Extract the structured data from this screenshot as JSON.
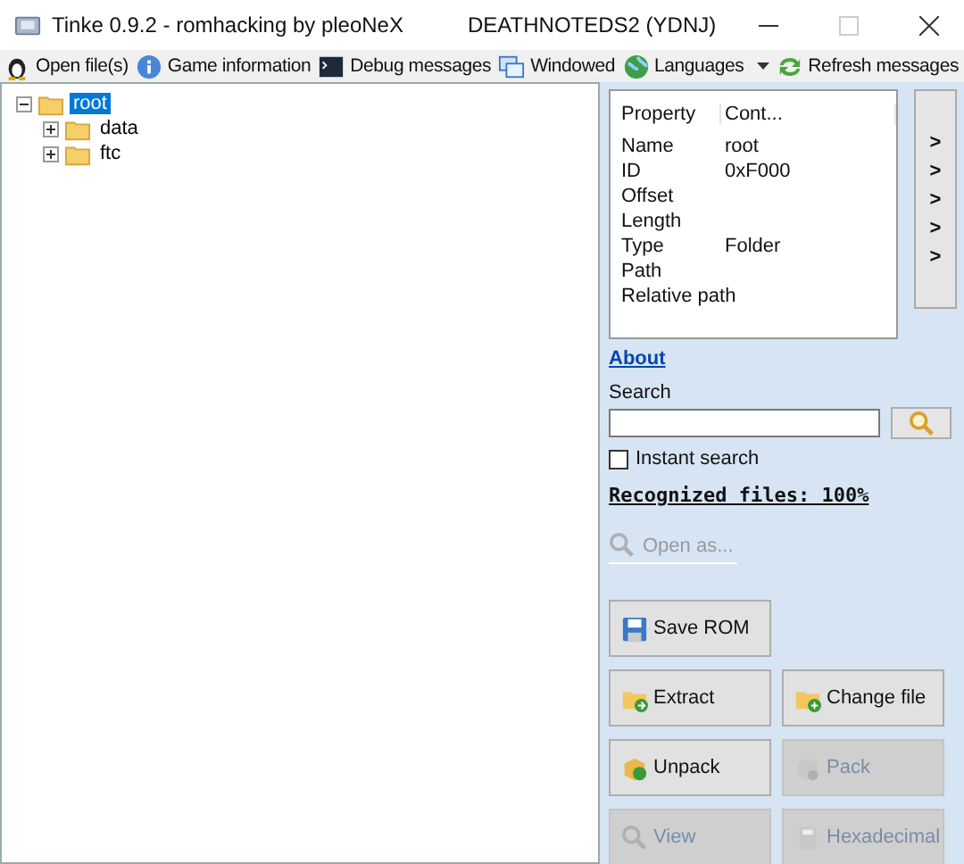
{
  "window": {
    "title": "Tinke 0.9.2 - romhacking by pleoNeX",
    "subtitle": "DEATHNOTEDS2 (YDNJ)"
  },
  "toolbar": [
    {
      "label": "Open file(s)",
      "kind": "button"
    },
    {
      "label": "Game information",
      "kind": "button"
    },
    {
      "label": "Debug messages",
      "kind": "button"
    },
    {
      "label": "Windowed",
      "kind": "button"
    },
    {
      "label": "Languages",
      "kind": "dropdown"
    },
    {
      "label": "Refresh messages",
      "kind": "button"
    }
  ],
  "tree": [
    {
      "label": "root",
      "selected": true,
      "expanded": true,
      "children": [
        {
          "label": "data",
          "selected": false,
          "expanded": false
        },
        {
          "label": "ftc",
          "selected": false,
          "expanded": false
        }
      ]
    }
  ],
  "properties": {
    "columns": [
      "Property",
      "Cont..."
    ],
    "rows": [
      [
        "Name",
        "root"
      ],
      [
        "ID",
        "0xF000"
      ],
      [
        "Offset",
        ""
      ],
      [
        "Length",
        ""
      ],
      [
        "Type",
        "Folder"
      ],
      [
        "Path",
        ""
      ],
      [
        "Relative path",
        ""
      ]
    ]
  },
  "side_arrows": [
    ">",
    ">",
    ">",
    ">",
    ">"
  ],
  "about_link": "About",
  "search": {
    "label": "Search"
  },
  "instant_search": {
    "label": "Instant search",
    "checked": false
  },
  "recognized": "Recognized files: 100%",
  "open_as": {
    "label": "Open as...",
    "disabled": true
  },
  "actions": [
    [
      {
        "label": "Save ROM",
        "disabled": false
      }
    ],
    [
      {
        "label": "Extract",
        "disabled": false
      },
      {
        "label": "Change file",
        "disabled": false
      }
    ],
    [
      {
        "label": "Unpack",
        "disabled": false
      },
      {
        "label": "Pack",
        "disabled": true
      }
    ],
    [
      {
        "label": "View",
        "disabled": true
      },
      {
        "label": "Hexadecimal",
        "disabled": true
      }
    ]
  ]
}
